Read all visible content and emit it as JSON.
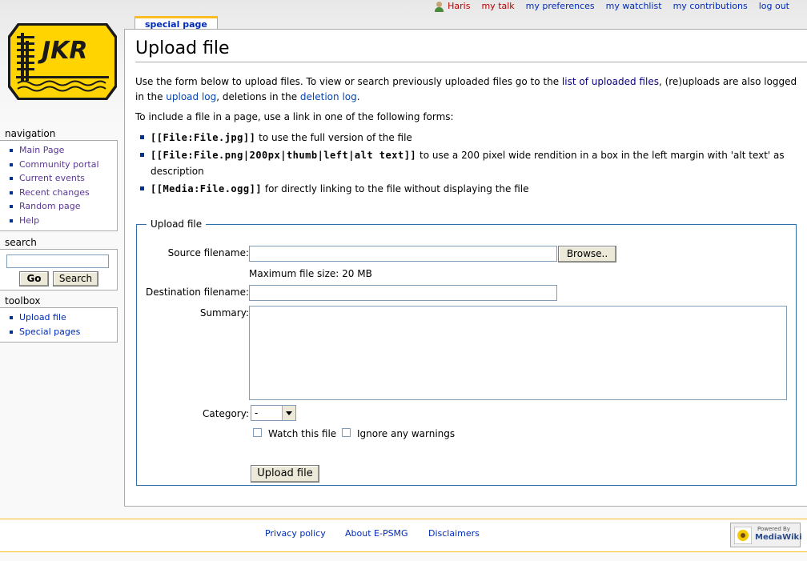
{
  "personal": {
    "user": "Haris",
    "talk": "my talk",
    "preferences": "my preferences",
    "watchlist": "my watchlist",
    "contributions": "my contributions",
    "logout": "log out"
  },
  "logo": {
    "text": "JKR"
  },
  "tab": {
    "label": "special page"
  },
  "page": {
    "title": "Upload file",
    "intro_1": "Use the form below to upload files. To view or search previously uploaded files go to the ",
    "link_uploaded": "list of uploaded files",
    "intro_2": ", (re)uploads are also logged in the ",
    "link_upload_log": "upload log",
    "intro_3": ", deletions in the ",
    "link_deletion_log": "deletion log",
    "intro_4": ".",
    "include_line": "To include a file in a page, use a link in one of the following forms:",
    "forms": [
      {
        "code": "[[File:File.jpg]]",
        "desc": " to use the full version of the file"
      },
      {
        "code": "[[File:File.png|200px|thumb|left|alt text]]",
        "desc": " to use a 200 pixel wide rendition in a box in the left margin with 'alt text' as description"
      },
      {
        "code": "[[Media:File.ogg]]",
        "desc": " for directly linking to the file without displaying the file"
      }
    ]
  },
  "upload_form": {
    "legend": "Upload file",
    "source_label": "Source filename:",
    "source_value": "",
    "browse": "Browse..",
    "max_size": "Maximum file size: 20 MB",
    "dest_label": "Destination filename:",
    "dest_value": "",
    "summary_label": "Summary:",
    "summary_value": "",
    "category_label": "Category:",
    "category_selected": "-",
    "watch_label": "Watch this file",
    "ignore_label": "Ignore any warnings",
    "watch_checked": false,
    "ignore_checked": false,
    "submit": "Upload file"
  },
  "sidebar": {
    "navigation": {
      "title": "navigation",
      "items": [
        "Main Page",
        "Community portal",
        "Current events",
        "Recent changes",
        "Random page",
        "Help"
      ]
    },
    "search": {
      "title": "search",
      "value": "",
      "go": "Go",
      "search": "Search"
    },
    "toolbox": {
      "title": "toolbox",
      "items": [
        "Upload file",
        "Special pages"
      ]
    }
  },
  "footer": {
    "privacy": "Privacy policy",
    "about": "About E-PSMG",
    "disclaimers": "Disclaimers",
    "powered_small": "Powered By",
    "powered_big": "MediaWiki"
  },
  "colors": {
    "accent": "#fabd23",
    "link": "#002bb8",
    "newlink": "#ba0000",
    "logo_yellow": "#ffd400"
  }
}
